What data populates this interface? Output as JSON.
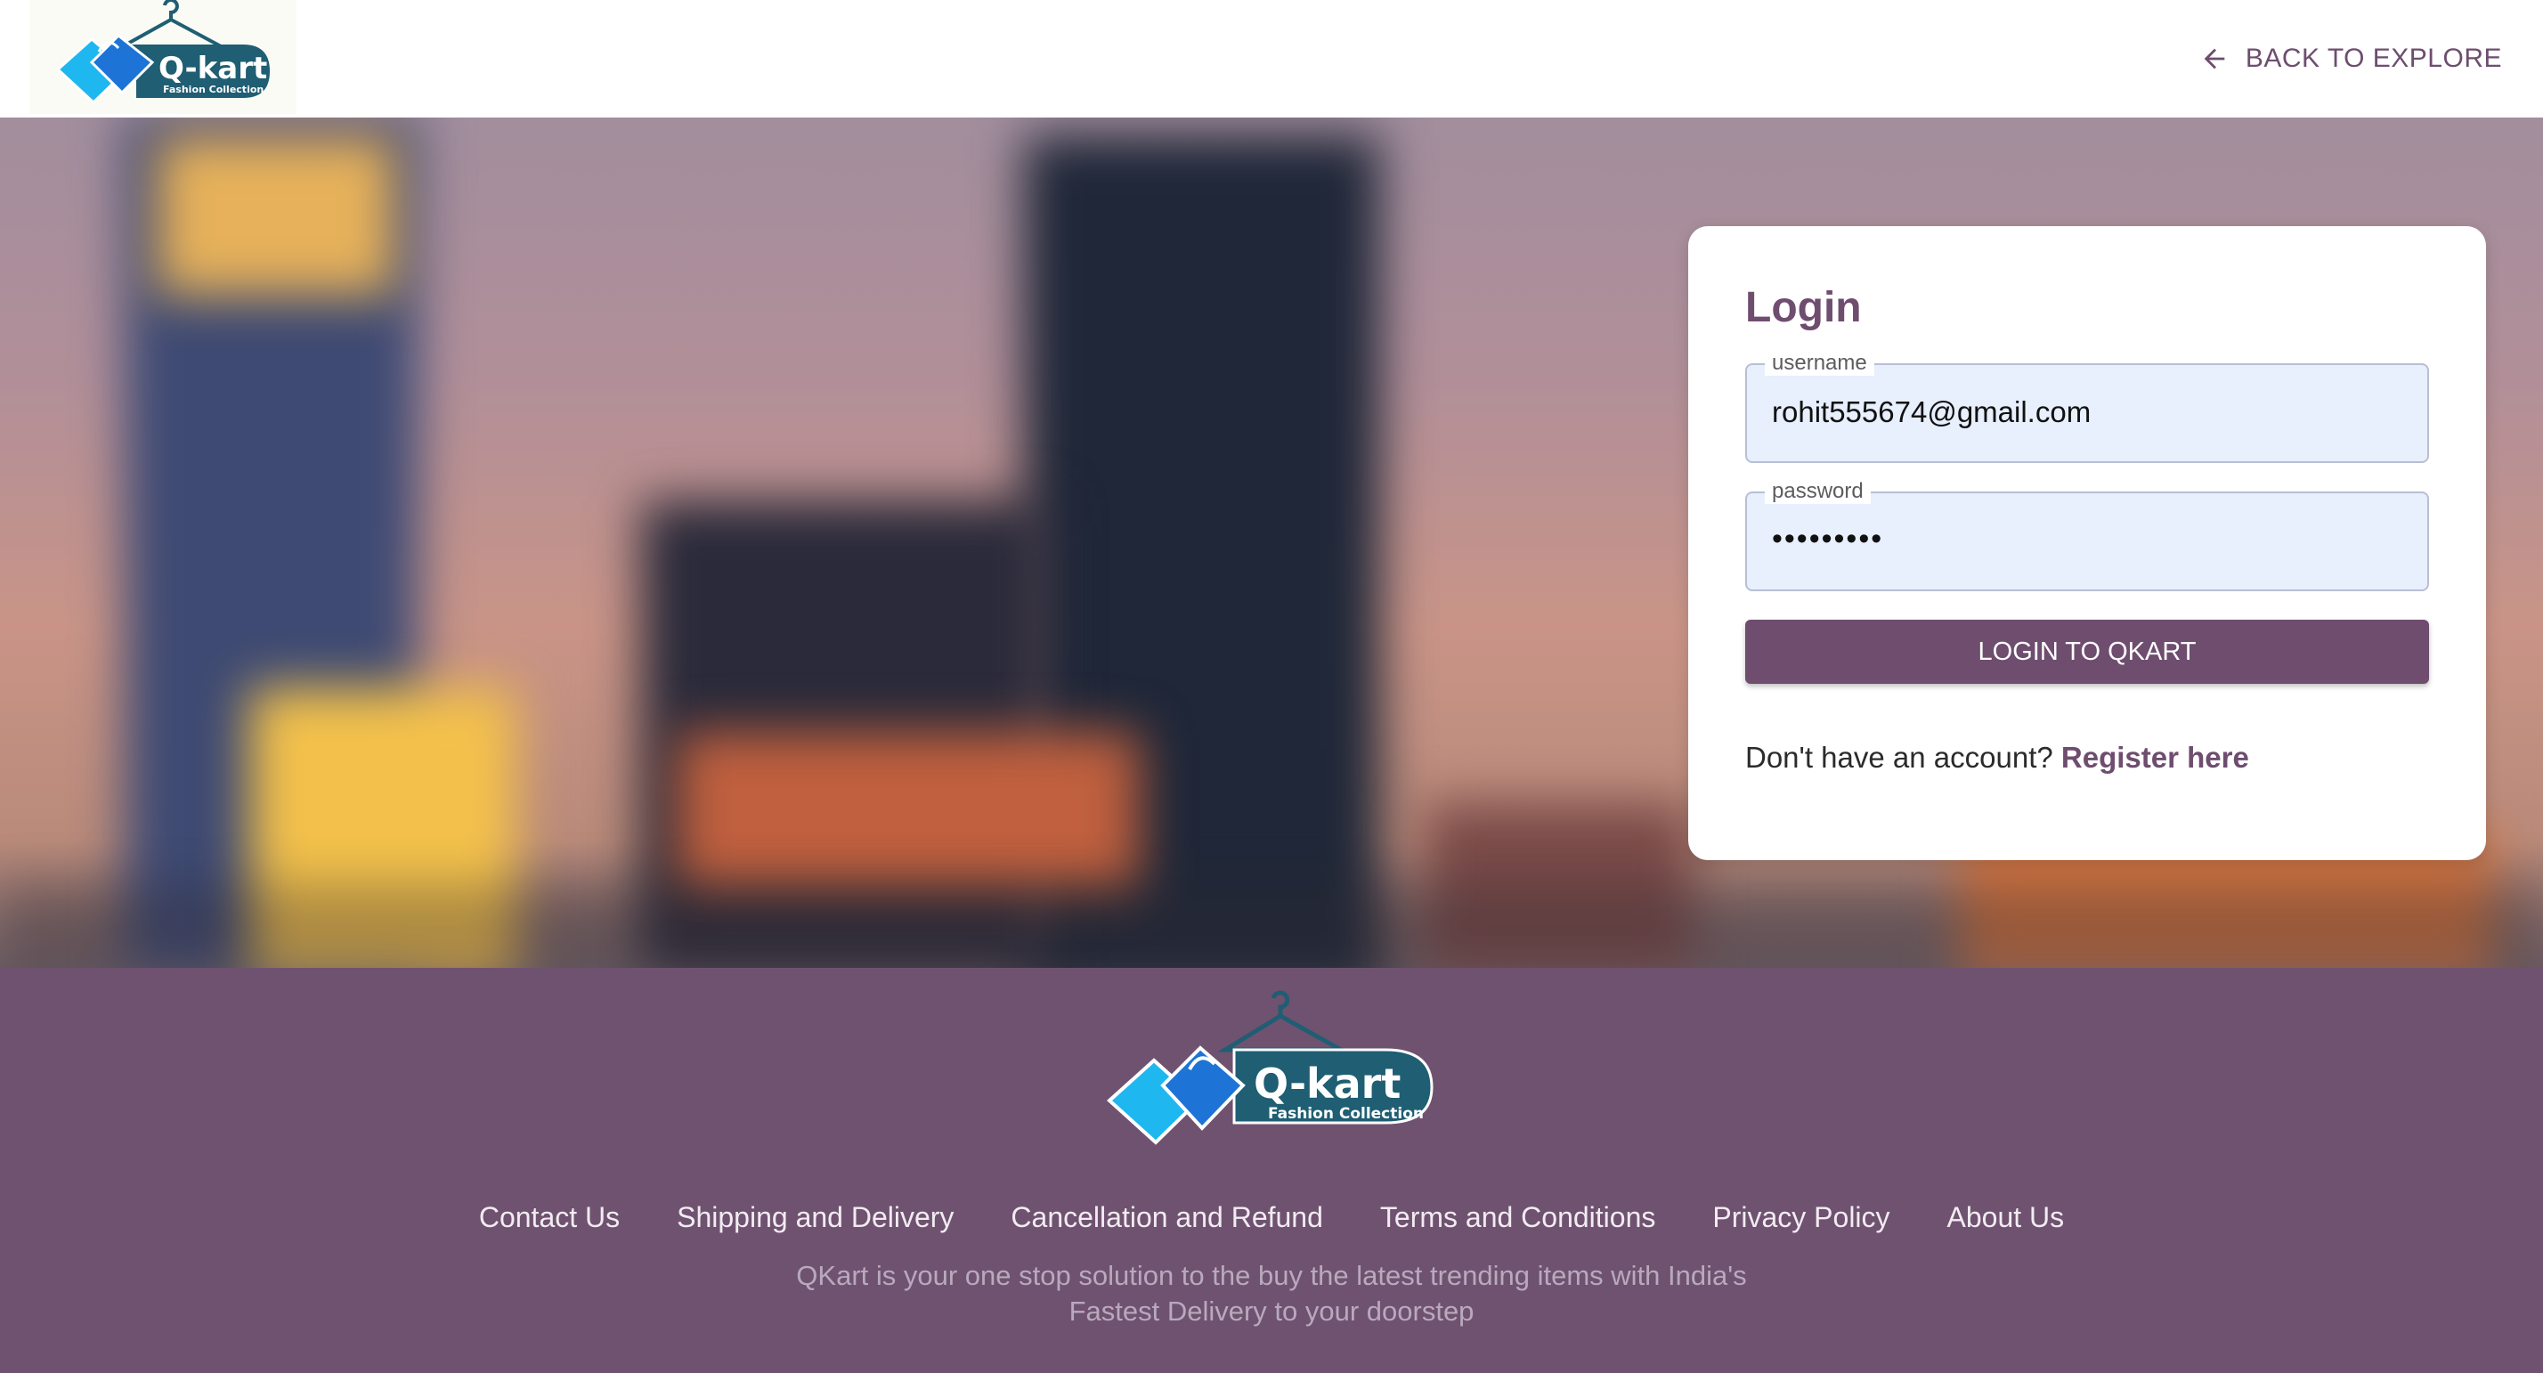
{
  "header": {
    "logo": {
      "brand": "Q-kart",
      "tagline": "Fashion Collection"
    },
    "back_label": "BACK TO EXPLORE",
    "back_icon": "arrow-left-icon"
  },
  "login": {
    "title": "Login",
    "username_label": "username",
    "username_value": "rohit555674@gmail.com",
    "password_label": "password",
    "password_value": "•••••••••",
    "submit_label": "LOGIN TO QKART",
    "register_prompt": "Don't have an account?",
    "register_link": "Register here"
  },
  "footer": {
    "logo": {
      "brand": "Q-kart",
      "tagline": "Fashion Collection"
    },
    "links": [
      "Contact Us",
      "Shipping and Delivery",
      "Cancellation and Refund",
      "Terms and Conditions",
      "Privacy Policy",
      "About Us"
    ],
    "description_line1": "QKart is your one stop solution to the buy the latest trending items with India's",
    "description_line2": "Fastest Delivery to your doorstep"
  },
  "colors": {
    "primary": "#6e4d6f",
    "footer_bg": "#6f5270",
    "input_bg": "#e8effd",
    "logo_teal": "#1f5e73",
    "logo_blue": "#29a3e6"
  }
}
